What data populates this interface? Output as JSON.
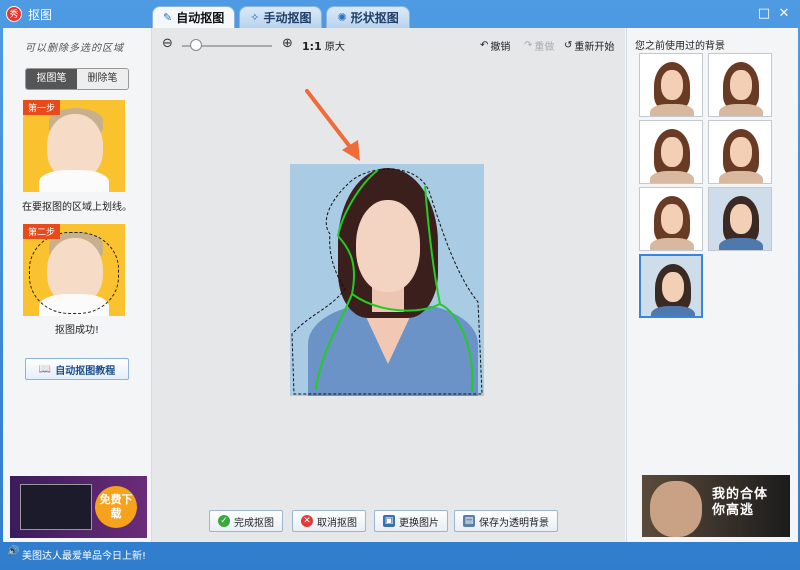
{
  "window": {
    "title": "抠图",
    "logo_text": "秀"
  },
  "tabs": [
    {
      "label": "自动抠图",
      "active": true
    },
    {
      "label": "手动抠图",
      "active": false
    },
    {
      "label": "形状抠图",
      "active": false
    }
  ],
  "left": {
    "hint": "可以删除多选的区域",
    "pen_mode": "抠图笔",
    "eraser_mode": "删除笔",
    "step1_badge": "第一步",
    "step1_caption": "在要抠图的区域上划线。",
    "step2_badge": "第二步",
    "step2_caption": "抠图成功!",
    "tutorial_button": "自动抠图教程",
    "ad": {
      "badge": "免费下载"
    }
  },
  "toolbar": {
    "zoom_ratio": "1:1",
    "actual_size": "原大",
    "undo": "撤销",
    "redo": "重做",
    "restart": "重新开始",
    "zoom_level": 0.15
  },
  "bottom": {
    "done": "完成抠图",
    "cancel": "取消抠图",
    "replace": "更换图片",
    "save_transparent": "保存为透明背景"
  },
  "right": {
    "title": "您之前使用过的背景",
    "thumbnails": 7,
    "selected_index": 6,
    "ad": {
      "text_line1": "我的合体",
      "text_line2": "你高逃"
    }
  },
  "status": {
    "text": "美图达人最爱单品今日上新!"
  },
  "colors": {
    "accent": "#3a86d6",
    "selection_stroke": "#22cc22",
    "arrow": "#f06a3a"
  }
}
